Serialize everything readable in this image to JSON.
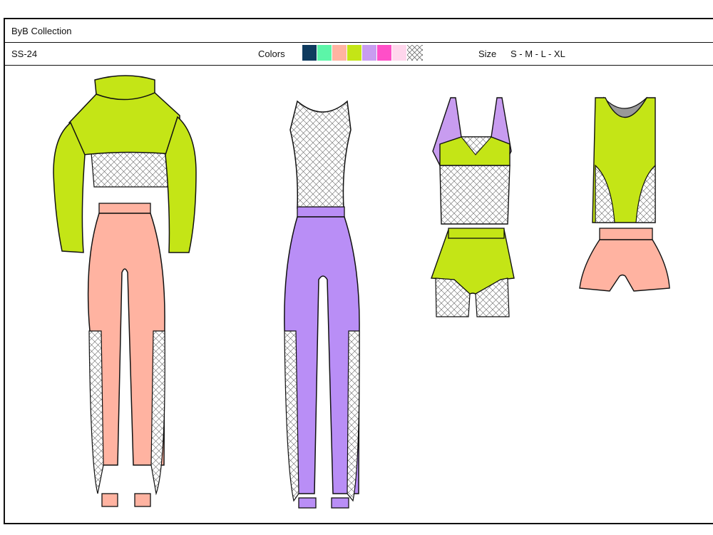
{
  "sheet": {
    "collection": "ByB Collection",
    "season": "SS-24",
    "colors_label": "Colors",
    "size_label": "Size",
    "sizes": "S - M - L - XL"
  },
  "palette": [
    {
      "name": "navy",
      "hex": "#0f3b5f"
    },
    {
      "name": "mint",
      "hex": "#5cf5a8"
    },
    {
      "name": "peach",
      "hex": "#ffb3a1"
    },
    {
      "name": "lime",
      "hex": "#c4e516"
    },
    {
      "name": "lavender",
      "hex": "#c89cf0"
    },
    {
      "name": "hot-pink",
      "hex": "#ff4fc8"
    },
    {
      "name": "light-pink",
      "hex": "#ffd6ec"
    },
    {
      "name": "mesh",
      "hex": "mesh-pattern"
    }
  ],
  "garments": [
    {
      "name": "crop-sweater-mesh-top-jogger-set",
      "main": "#c4e516",
      "bottom": "#ffb3a1"
    },
    {
      "name": "mesh-bodice-jumpsuit",
      "main": "#b98ef6",
      "bottom": "#b98ef6"
    },
    {
      "name": "strappy-bra-top-and-shorts",
      "main": "#c4e516",
      "trim": "#c89cf0"
    },
    {
      "name": "tank-and-shorts",
      "main": "#c4e516",
      "bottom": "#ffb3a1"
    }
  ]
}
